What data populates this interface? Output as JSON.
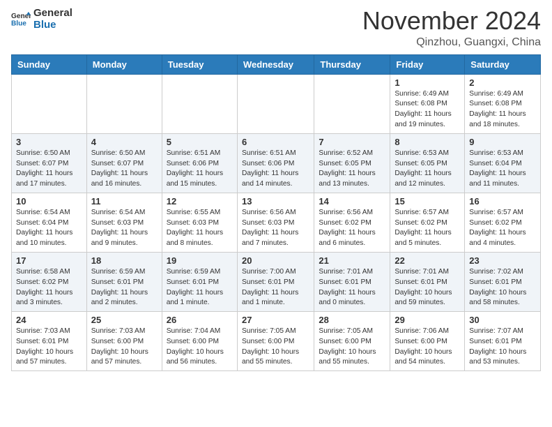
{
  "logo": {
    "line1": "General",
    "line2": "Blue"
  },
  "header": {
    "month": "November 2024",
    "location": "Qinzhou, Guangxi, China"
  },
  "weekdays": [
    "Sunday",
    "Monday",
    "Tuesday",
    "Wednesday",
    "Thursday",
    "Friday",
    "Saturday"
  ],
  "weeks": [
    [
      {
        "day": "",
        "info": ""
      },
      {
        "day": "",
        "info": ""
      },
      {
        "day": "",
        "info": ""
      },
      {
        "day": "",
        "info": ""
      },
      {
        "day": "",
        "info": ""
      },
      {
        "day": "1",
        "info": "Sunrise: 6:49 AM\nSunset: 6:08 PM\nDaylight: 11 hours and 19 minutes."
      },
      {
        "day": "2",
        "info": "Sunrise: 6:49 AM\nSunset: 6:08 PM\nDaylight: 11 hours and 18 minutes."
      }
    ],
    [
      {
        "day": "3",
        "info": "Sunrise: 6:50 AM\nSunset: 6:07 PM\nDaylight: 11 hours and 17 minutes."
      },
      {
        "day": "4",
        "info": "Sunrise: 6:50 AM\nSunset: 6:07 PM\nDaylight: 11 hours and 16 minutes."
      },
      {
        "day": "5",
        "info": "Sunrise: 6:51 AM\nSunset: 6:06 PM\nDaylight: 11 hours and 15 minutes."
      },
      {
        "day": "6",
        "info": "Sunrise: 6:51 AM\nSunset: 6:06 PM\nDaylight: 11 hours and 14 minutes."
      },
      {
        "day": "7",
        "info": "Sunrise: 6:52 AM\nSunset: 6:05 PM\nDaylight: 11 hours and 13 minutes."
      },
      {
        "day": "8",
        "info": "Sunrise: 6:53 AM\nSunset: 6:05 PM\nDaylight: 11 hours and 12 minutes."
      },
      {
        "day": "9",
        "info": "Sunrise: 6:53 AM\nSunset: 6:04 PM\nDaylight: 11 hours and 11 minutes."
      }
    ],
    [
      {
        "day": "10",
        "info": "Sunrise: 6:54 AM\nSunset: 6:04 PM\nDaylight: 11 hours and 10 minutes."
      },
      {
        "day": "11",
        "info": "Sunrise: 6:54 AM\nSunset: 6:03 PM\nDaylight: 11 hours and 9 minutes."
      },
      {
        "day": "12",
        "info": "Sunrise: 6:55 AM\nSunset: 6:03 PM\nDaylight: 11 hours and 8 minutes."
      },
      {
        "day": "13",
        "info": "Sunrise: 6:56 AM\nSunset: 6:03 PM\nDaylight: 11 hours and 7 minutes."
      },
      {
        "day": "14",
        "info": "Sunrise: 6:56 AM\nSunset: 6:02 PM\nDaylight: 11 hours and 6 minutes."
      },
      {
        "day": "15",
        "info": "Sunrise: 6:57 AM\nSunset: 6:02 PM\nDaylight: 11 hours and 5 minutes."
      },
      {
        "day": "16",
        "info": "Sunrise: 6:57 AM\nSunset: 6:02 PM\nDaylight: 11 hours and 4 minutes."
      }
    ],
    [
      {
        "day": "17",
        "info": "Sunrise: 6:58 AM\nSunset: 6:02 PM\nDaylight: 11 hours and 3 minutes."
      },
      {
        "day": "18",
        "info": "Sunrise: 6:59 AM\nSunset: 6:01 PM\nDaylight: 11 hours and 2 minutes."
      },
      {
        "day": "19",
        "info": "Sunrise: 6:59 AM\nSunset: 6:01 PM\nDaylight: 11 hours and 1 minute."
      },
      {
        "day": "20",
        "info": "Sunrise: 7:00 AM\nSunset: 6:01 PM\nDaylight: 11 hours and 1 minute."
      },
      {
        "day": "21",
        "info": "Sunrise: 7:01 AM\nSunset: 6:01 PM\nDaylight: 11 hours and 0 minutes."
      },
      {
        "day": "22",
        "info": "Sunrise: 7:01 AM\nSunset: 6:01 PM\nDaylight: 10 hours and 59 minutes."
      },
      {
        "day": "23",
        "info": "Sunrise: 7:02 AM\nSunset: 6:01 PM\nDaylight: 10 hours and 58 minutes."
      }
    ],
    [
      {
        "day": "24",
        "info": "Sunrise: 7:03 AM\nSunset: 6:01 PM\nDaylight: 10 hours and 57 minutes."
      },
      {
        "day": "25",
        "info": "Sunrise: 7:03 AM\nSunset: 6:00 PM\nDaylight: 10 hours and 57 minutes."
      },
      {
        "day": "26",
        "info": "Sunrise: 7:04 AM\nSunset: 6:00 PM\nDaylight: 10 hours and 56 minutes."
      },
      {
        "day": "27",
        "info": "Sunrise: 7:05 AM\nSunset: 6:00 PM\nDaylight: 10 hours and 55 minutes."
      },
      {
        "day": "28",
        "info": "Sunrise: 7:05 AM\nSunset: 6:00 PM\nDaylight: 10 hours and 55 minutes."
      },
      {
        "day": "29",
        "info": "Sunrise: 7:06 AM\nSunset: 6:00 PM\nDaylight: 10 hours and 54 minutes."
      },
      {
        "day": "30",
        "info": "Sunrise: 7:07 AM\nSunset: 6:01 PM\nDaylight: 10 hours and 53 minutes."
      }
    ]
  ]
}
